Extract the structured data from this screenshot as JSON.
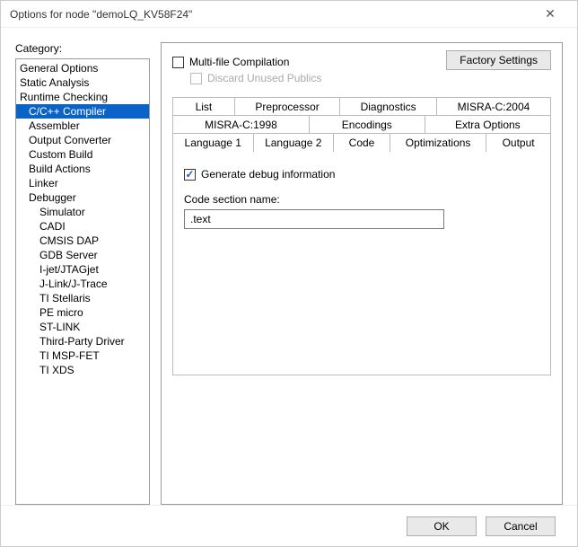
{
  "window": {
    "title": "Options for node \"demoLQ_KV58F24\""
  },
  "left": {
    "category_label": "Category:",
    "items": [
      {
        "label": "General Options",
        "indent": 0
      },
      {
        "label": "Static Analysis",
        "indent": 0
      },
      {
        "label": "Runtime Checking",
        "indent": 0
      },
      {
        "label": "C/C++ Compiler",
        "indent": 1,
        "selected": true
      },
      {
        "label": "Assembler",
        "indent": 1
      },
      {
        "label": "Output Converter",
        "indent": 1
      },
      {
        "label": "Custom Build",
        "indent": 1
      },
      {
        "label": "Build Actions",
        "indent": 1
      },
      {
        "label": "Linker",
        "indent": 1
      },
      {
        "label": "Debugger",
        "indent": 1
      },
      {
        "label": "Simulator",
        "indent": 2
      },
      {
        "label": "CADI",
        "indent": 2
      },
      {
        "label": "CMSIS DAP",
        "indent": 2
      },
      {
        "label": "GDB Server",
        "indent": 2
      },
      {
        "label": "I-jet/JTAGjet",
        "indent": 2
      },
      {
        "label": "J-Link/J-Trace",
        "indent": 2
      },
      {
        "label": "TI Stellaris",
        "indent": 2
      },
      {
        "label": "PE micro",
        "indent": 2
      },
      {
        "label": "ST-LINK",
        "indent": 2
      },
      {
        "label": "Third-Party Driver",
        "indent": 2
      },
      {
        "label": "TI MSP-FET",
        "indent": 2
      },
      {
        "label": "TI XDS",
        "indent": 2
      }
    ]
  },
  "right": {
    "factory_btn": "Factory Settings",
    "multi_file": "Multi-file Compilation",
    "discard": "Discard Unused Publics",
    "tabs_row1": [
      "List",
      "Preprocessor",
      "Diagnostics",
      "MISRA-C:2004"
    ],
    "tabs_row2": [
      "MISRA-C:1998",
      "Encodings",
      "Extra Options"
    ],
    "tabs_row3": [
      "Language 1",
      "Language 2",
      "Code",
      "Optimizations",
      "Output"
    ],
    "active_tab": "Output",
    "gen_debug": "Generate debug information",
    "code_section_label": "Code section name:",
    "code_section_value": ".text"
  },
  "footer": {
    "ok": "OK",
    "cancel": "Cancel"
  }
}
